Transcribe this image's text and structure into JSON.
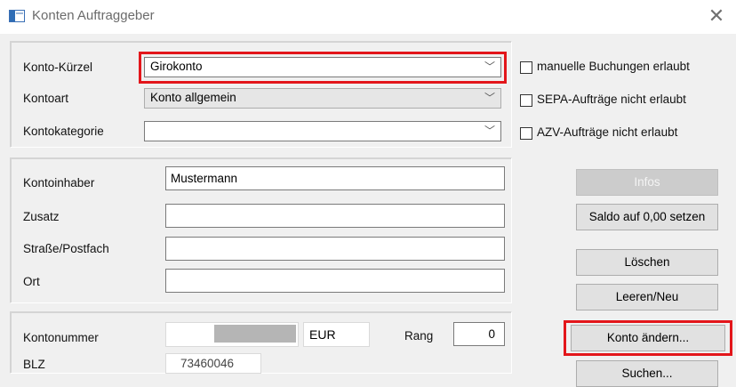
{
  "window": {
    "title": "Konten Auftraggeber",
    "close_glyph": "✕"
  },
  "konto_group": {
    "kuerzel_label": "Konto-Kürzel",
    "kuerzel_value": "Girokonto",
    "kontoart_label": "Kontoart",
    "kontoart_value": "Konto allgemein",
    "kategorie_label": "Kontokategorie",
    "kategorie_value": ""
  },
  "checkboxes": {
    "manuelle_label": "manuelle Buchungen erlaubt",
    "sepa_label": "SEPA-Aufträge nicht erlaubt",
    "azv_label": "AZV-Aufträge nicht erlaubt"
  },
  "inhaber_group": {
    "kontoinhaber_label": "Kontoinhaber",
    "kontoinhaber_value": "Mustermann",
    "zusatz_label": "Zusatz",
    "zusatz_value": "",
    "strasse_label": "Straße/Postfach",
    "strasse_value": "",
    "ort_label": "Ort",
    "ort_value": ""
  },
  "konto_details": {
    "kontonummer_label": "Kontonummer",
    "currency": "EUR",
    "rang_label": "Rang",
    "rang_value": "0",
    "blz_label": "BLZ",
    "blz_value": "73460046"
  },
  "buttons": {
    "infos": "Infos",
    "saldo": "Saldo auf 0,00 setzen",
    "loeschen": "Löschen",
    "leeren": "Leeren/Neu",
    "konto_aendern": "Konto ändern...",
    "suchen": "Suchen..."
  },
  "colors": {
    "highlight": "#e3161b",
    "dialog_bg": "#f0f0f0"
  }
}
